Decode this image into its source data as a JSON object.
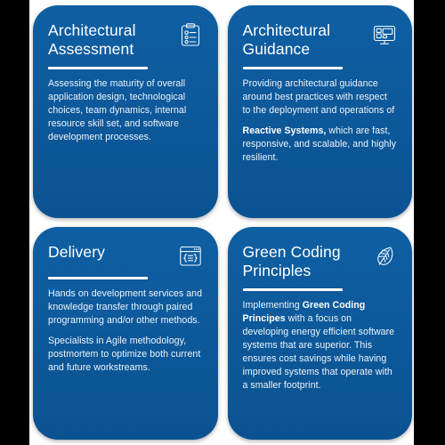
{
  "theme": {
    "page_background": "#000000",
    "canvas_background": "#ffffff",
    "card_background": "#0e5c9e",
    "card_text": "#ffffff",
    "divider_color": "#ffffff"
  },
  "cards": [
    {
      "id": "architectural-assessment",
      "title": "Architectural Assessment",
      "icon": "clipboard-checklist-icon",
      "paragraphs": [
        {
          "runs": [
            {
              "text": "Assessing the maturity of overall application design, technological choices, team dynamics, internal resource skill set, and software development processes.",
              "bold": false
            }
          ]
        }
      ]
    },
    {
      "id": "architectural-guidance",
      "title": "Architectural Guidance",
      "icon": "monitor-wireframe-icon",
      "paragraphs": [
        {
          "runs": [
            {
              "text": "Providing architectural guidance around best practices with respect to the deployment and operations of ",
              "bold": false
            }
          ]
        },
        {
          "runs": [
            {
              "text": "Reactive Systems,",
              "bold": true
            },
            {
              "text": " which are fast, responsive, and scalable, and highly resilient.",
              "bold": false
            }
          ]
        }
      ]
    },
    {
      "id": "delivery",
      "title": "Delivery",
      "icon": "code-window-icon",
      "paragraphs": [
        {
          "runs": [
            {
              "text": "Hands on development services and knowledge transfer through paired programming and/or other methods.",
              "bold": false
            }
          ]
        },
        {
          "runs": [
            {
              "text": "Specialists in Agile methodology, postmortem to optimize both current and future workstreams.",
              "bold": false
            }
          ]
        }
      ]
    },
    {
      "id": "green-coding-principles",
      "title": "Green Coding Principles",
      "icon": "leaf-icon",
      "paragraphs": [
        {
          "runs": [
            {
              "text": "Implementing  ",
              "bold": false
            },
            {
              "text": "Green Coding Principes",
              "bold": true
            },
            {
              "text": " with a focus on developing energy efficient software systems that are superior. This ensures cost savings while having improved systems that operate with a smaller footprint.",
              "bold": false
            }
          ]
        }
      ]
    }
  ]
}
